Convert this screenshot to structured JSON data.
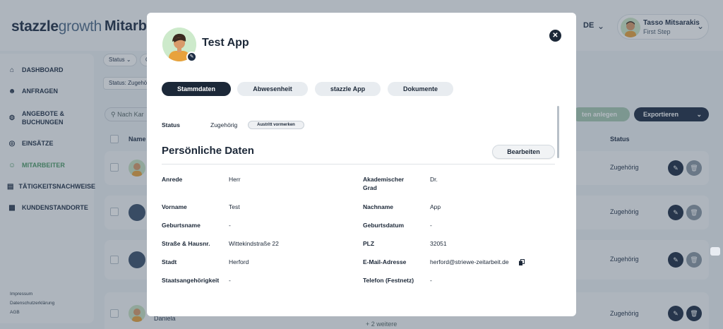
{
  "app": {
    "logo_primary": "stazzle",
    "logo_secondary": "growth",
    "page_title": "Mitarb",
    "language": "DE",
    "user": {
      "name": "Tasso Mitsarakis",
      "role": "First Step"
    }
  },
  "sidebar": {
    "items": [
      {
        "label": "DASHBOARD",
        "icon": "home-icon"
      },
      {
        "label": "ANFRAGEN",
        "icon": "user-plus-icon"
      },
      {
        "label": "ANGEBOTE &",
        "label2": "BUCHUNGEN",
        "icon": "offers-icon"
      },
      {
        "label": "EINSÄTZE",
        "icon": "target-icon"
      },
      {
        "label": "MITARBEITER",
        "icon": "users-icon"
      },
      {
        "label": "TÄTIGKEITSNACHWEISE",
        "icon": "list-icon"
      },
      {
        "label": "KUNDENSTANDORTE",
        "icon": "building-icon"
      }
    ],
    "footer": [
      "Impressum",
      "Datenschutzerklärung",
      "AGB"
    ]
  },
  "toolbar": {
    "filter_status": "Status",
    "filter_q": "Q",
    "active_filter": "Status: Zugehör",
    "search_placeholder": "Nach Kar",
    "create_label": "ten anlegen",
    "export_label": "Exportieren"
  },
  "table": {
    "headers": {
      "name": "Name",
      "status": "Status"
    },
    "rows": [
      {
        "status": "Zugehörig"
      },
      {
        "status": "Zugehörig"
      },
      {
        "status": "Zugehörig"
      },
      {
        "status": "Zugehörig",
        "name": "Daniela",
        "more": "+ 2 weitere"
      }
    ]
  },
  "modal": {
    "title": "Test App",
    "tabs": [
      "Stammdaten",
      "Abwesenheit",
      "stazzle App",
      "Dokumente"
    ],
    "active_tab": 0,
    "status_label": "Status",
    "status_value": "Zugehörig",
    "status_button": "Austritt vormerken",
    "section_title": "Persönliche Daten",
    "edit_button": "Bearbeiten",
    "fields_left": [
      {
        "label": "Anrede",
        "value": "Herr"
      },
      {
        "label": "Vorname",
        "value": "Test"
      },
      {
        "label": "Geburtsname",
        "value": "-"
      },
      {
        "label": "Straße & Hausnr.",
        "value": "Wittekindstraße 22"
      },
      {
        "label": "Stadt",
        "value": "Herford"
      },
      {
        "label": "Staatsangehörigkeit",
        "value": "-"
      }
    ],
    "fields_right": [
      {
        "label": "Akademischer",
        "label2": "Grad",
        "value": "Dr."
      },
      {
        "label": "Nachname",
        "value": "App"
      },
      {
        "label": "Geburtsdatum",
        "value": "-"
      },
      {
        "label": "PLZ",
        "value": "32051"
      },
      {
        "label": "E-Mail-Adresse",
        "value": "herford@striewe-zeitarbeit.de"
      },
      {
        "label": "Telefon (Festnetz)",
        "value": "-"
      }
    ]
  },
  "colors": {
    "primary": "#1c2838",
    "accent_green": "#4c9a66",
    "overlay": "#37485a"
  }
}
